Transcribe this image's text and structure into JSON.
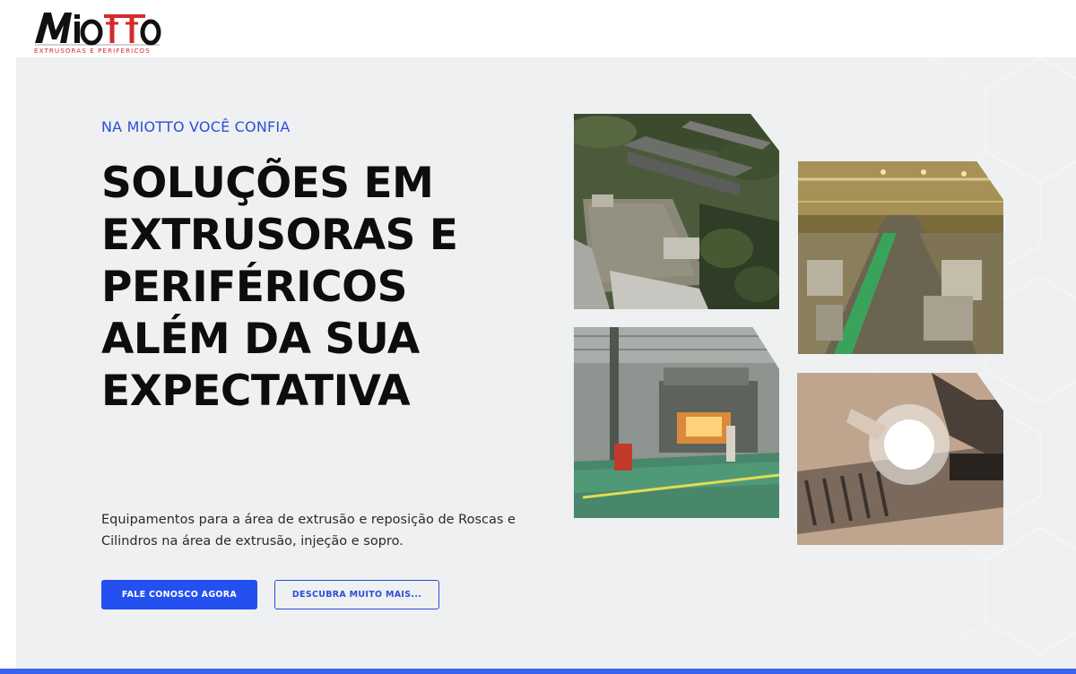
{
  "brand": {
    "name": "Miotto",
    "tagline": "EXTRUSORAS E PERIFÉRICOS",
    "colors": {
      "primary": "#2450f0",
      "logo_red": "#d42a2a",
      "logo_black": "#111111"
    }
  },
  "hero": {
    "eyebrow": "NA MIOTTO VOCÊ CONFIA",
    "headline_lines": [
      "SOLUÇÕES EM",
      "EXTRUSORAS E",
      "PERIFÉRICOS",
      "ALÉM DA SUA",
      "EXPECTATIVA"
    ],
    "lead_lines": [
      "Equipamentos para a área de extrusão e reposição de Roscas e",
      "Cilindros na área de extrusão, injeção e sopro."
    ],
    "cta_primary": "FALE CONOSCO AGORA",
    "cta_secondary": "DESCUBRA MUITO MAIS..."
  },
  "gallery": [
    {
      "subject": "aerial-factory-photo"
    },
    {
      "subject": "factory-floor-photo"
    },
    {
      "subject": "furnace-photo"
    },
    {
      "subject": "welding-screw-photo"
    }
  ]
}
